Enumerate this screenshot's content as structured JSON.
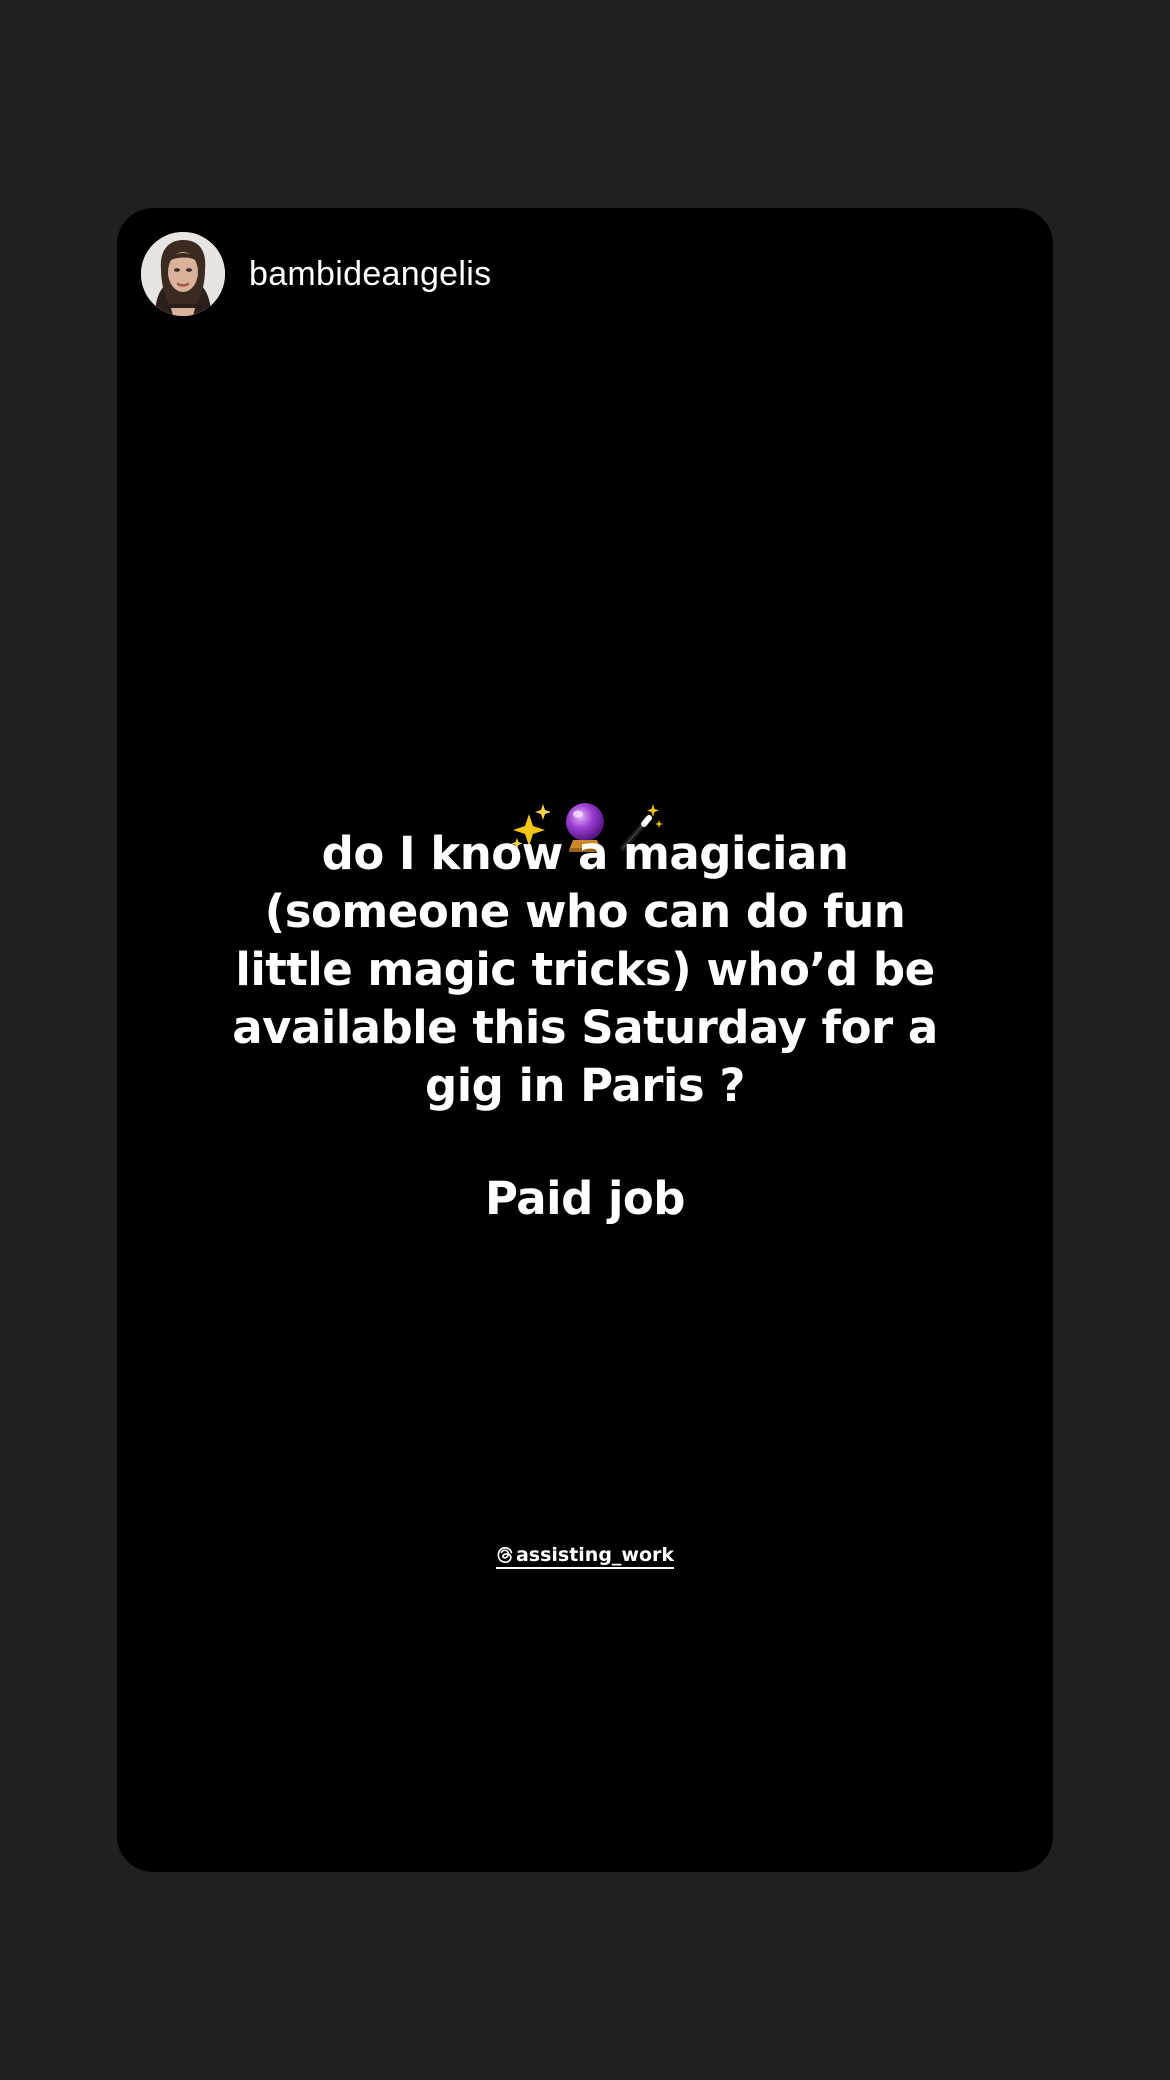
{
  "story": {
    "username": "bambideangelis",
    "avatar_icon": "profile-photo",
    "emojis": [
      "sparkles-icon",
      "crystal-ball-icon",
      "magic-wand-icon"
    ],
    "question_text": "do I know a magician (someone who can do fun little magic tricks) who’d be available this Saturday for a gig in Paris ?",
    "paid_text": "Paid job",
    "mention_text": "assisting_work",
    "mention_icon": "threads-icon"
  },
  "colors": {
    "page_background": "#202020",
    "card_background": "#000000",
    "text": "#ffffff"
  }
}
